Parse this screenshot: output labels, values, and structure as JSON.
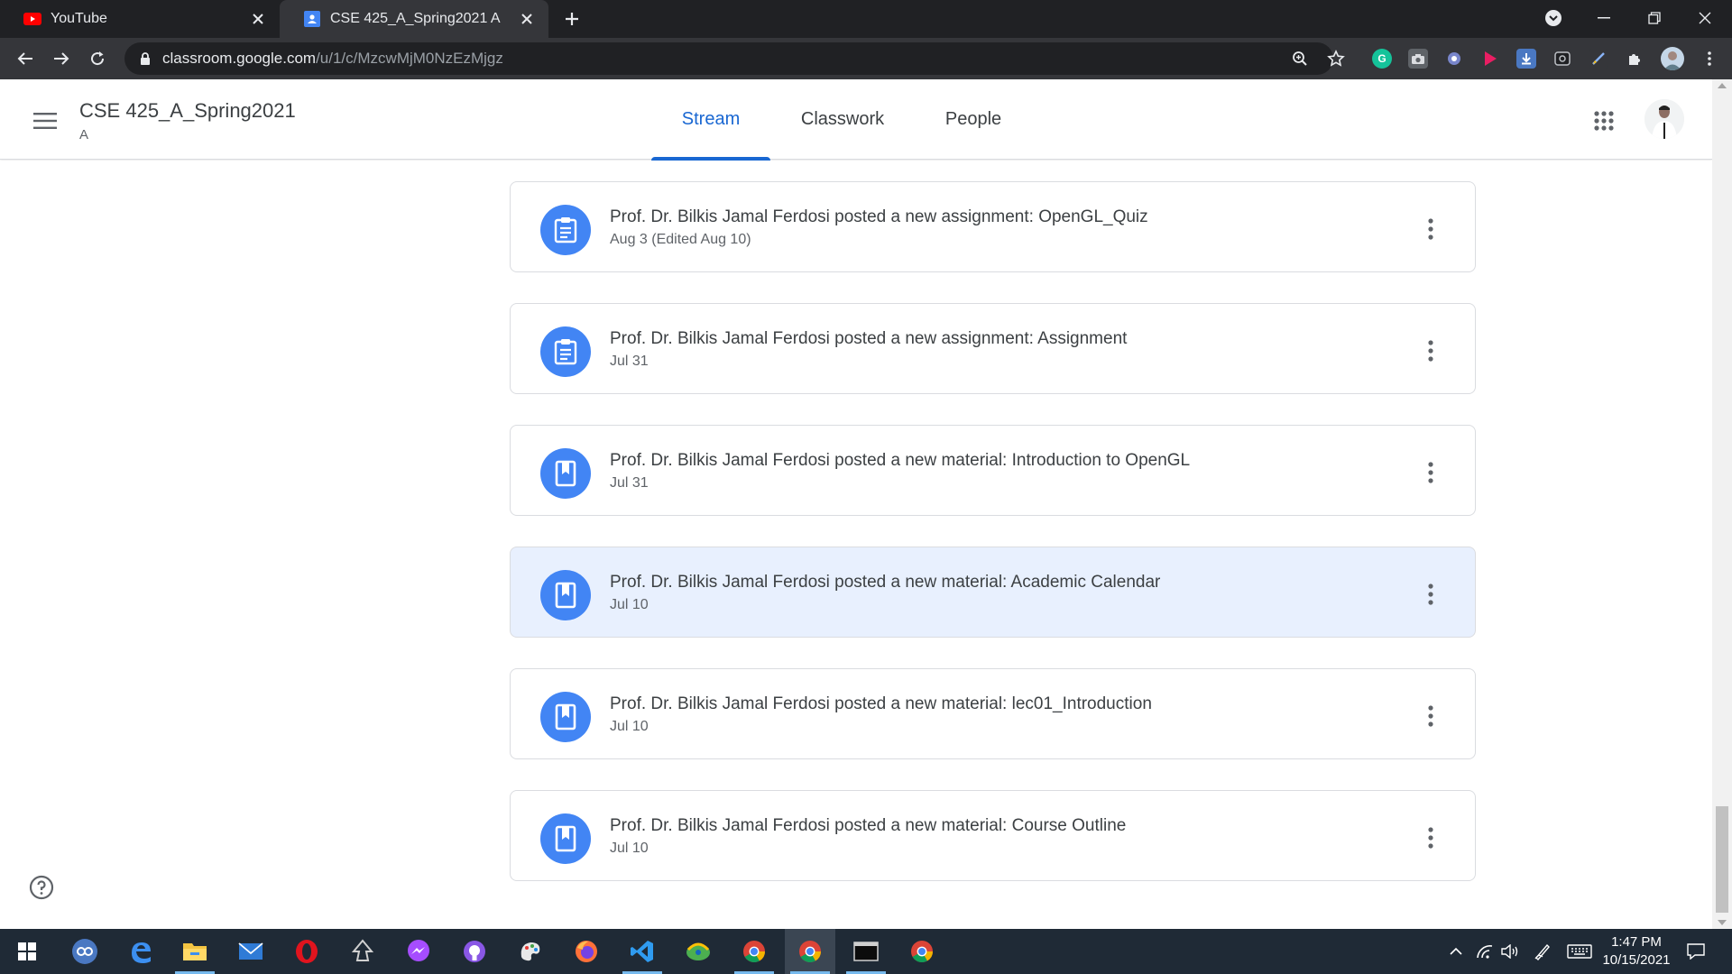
{
  "browser": {
    "tabs": [
      {
        "title": "YouTube",
        "active": false
      },
      {
        "title": "CSE 425_A_Spring2021 A",
        "active": true
      }
    ],
    "url_host": "classroom.google.com",
    "url_path": "/u/1/c/MzcwMjM0NzEzMjgz"
  },
  "classroom": {
    "class_title": "CSE 425_A_Spring2021",
    "section": "A",
    "tabs": {
      "stream": "Stream",
      "classwork": "Classwork",
      "people": "People"
    },
    "accent_color": "#1967d2"
  },
  "stream": {
    "posts": [
      {
        "type": "assignment",
        "icon": "assignment-icon",
        "title": "Prof. Dr. Bilkis Jamal Ferdosi posted a new assignment: OpenGL_Quiz",
        "date": "Aug 3 (Edited Aug 10)"
      },
      {
        "type": "assignment",
        "icon": "assignment-icon",
        "title": "Prof. Dr. Bilkis Jamal Ferdosi posted a new assignment: Assignment",
        "date": "Jul 31"
      },
      {
        "type": "material",
        "icon": "material-icon",
        "title": "Prof. Dr. Bilkis Jamal Ferdosi posted a new material: Introduction to OpenGL",
        "date": "Jul 31"
      },
      {
        "type": "material",
        "icon": "material-icon",
        "title": "Prof. Dr. Bilkis Jamal Ferdosi posted a new material: Academic Calendar",
        "date": "Jul 10"
      },
      {
        "type": "material",
        "icon": "material-icon",
        "title": "Prof. Dr. Bilkis Jamal Ferdosi posted a new material: lec01_Introduction",
        "date": "Jul 10"
      },
      {
        "type": "material",
        "icon": "material-icon",
        "title": "Prof. Dr. Bilkis Jamal Ferdosi posted a new material: Course Outline",
        "date": "Jul 10"
      }
    ]
  },
  "taskbar": {
    "time": "1:47 PM",
    "date": "10/15/2021"
  }
}
